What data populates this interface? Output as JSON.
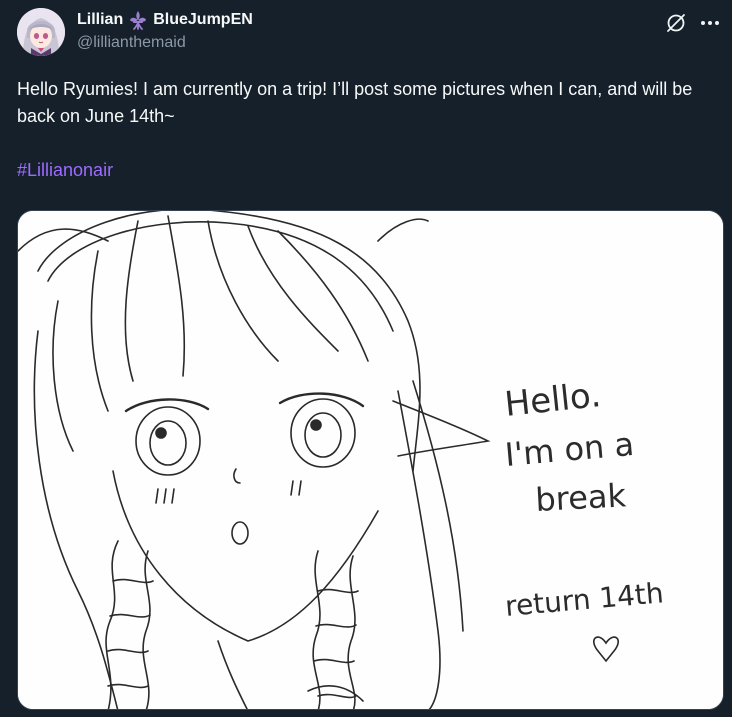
{
  "author": {
    "display_name_first": "Lillian",
    "display_name_second": "BlueJumpEN",
    "handle": "@lillianthemaid",
    "fleur_icon": "fleur-de-lis-icon"
  },
  "actions": {
    "grok_icon": "grok-icon",
    "more_icon": "more-icon"
  },
  "tweet": {
    "text": "Hello Ryumies! I am currently on a trip! I’ll post some pictures when I can, and will be back on June 14th~",
    "hashtag": "#Lillianonair"
  },
  "media": {
    "line1": "Hello.",
    "line2": "I'm on a",
    "line3": "break",
    "line4": "return 14th"
  },
  "colors": {
    "background": "#15202b",
    "text": "#f7f9f9",
    "muted": "#8b98a5",
    "hashtag": "#9d6bff",
    "fleur": "#9b7fd1"
  }
}
